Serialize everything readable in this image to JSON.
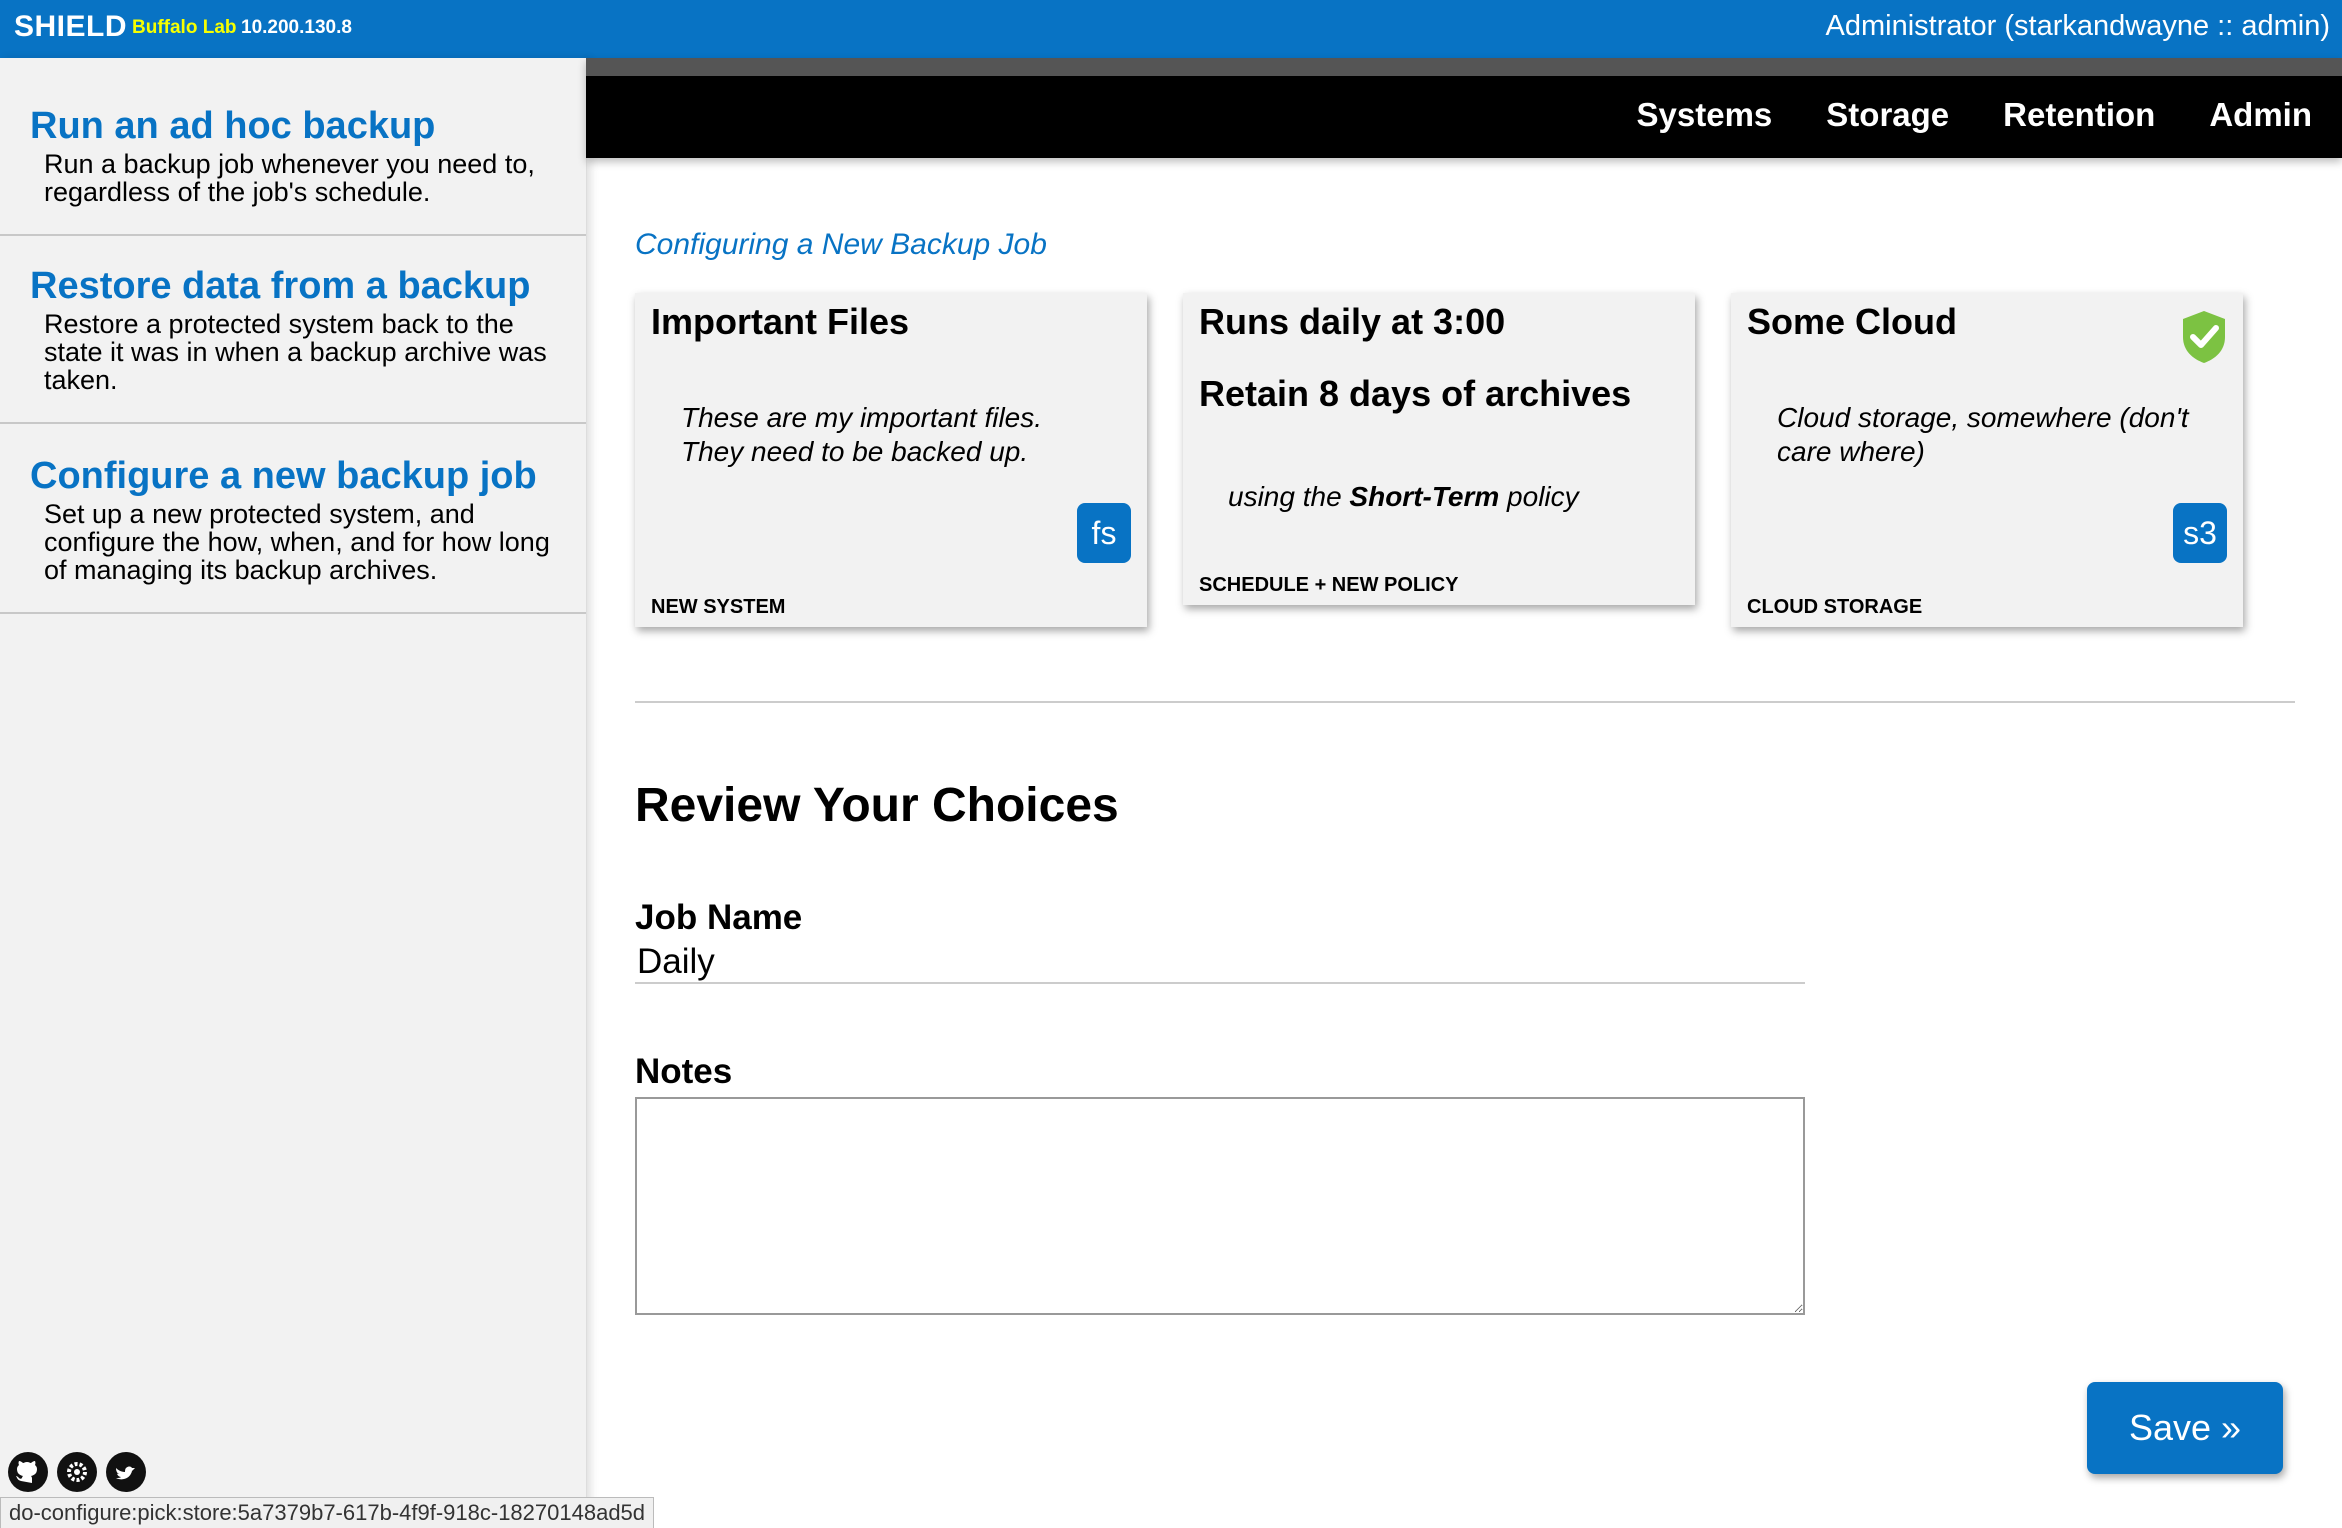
{
  "header": {
    "brand": "SHIELD",
    "environment": "Buffalo Lab",
    "ip": "10.200.130.8",
    "user": "Administrator (starkandwayne :: admin)"
  },
  "sidebar": {
    "items": [
      {
        "title": "Run an ad hoc backup",
        "description": "Run a backup job whenever you need to, regardless of the job's schedule."
      },
      {
        "title": "Restore data from a backup",
        "description": "Restore a protected system back to the state it was in when a backup archive was taken."
      },
      {
        "title": "Configure a new backup job",
        "description": "Set up a new protected system, and configure the how, when, and for how long of managing its backup archives."
      }
    ],
    "social_icons": [
      "github-icon",
      "settings-icon",
      "twitter-icon"
    ],
    "status_url": "do-configure:pick:store:5a7379b7-617b-4f9f-918c-18270148ad5d"
  },
  "nav": {
    "items": [
      "Systems",
      "Storage",
      "Retention",
      "Admin"
    ]
  },
  "main": {
    "subtitle": "Configuring a New Backup Job",
    "cards": {
      "system": {
        "title": "Important Files",
        "line1": "These are my important files.",
        "line2": "They need to be backed up.",
        "badge": "fs",
        "footer": "NEW SYSTEM"
      },
      "schedule": {
        "title": "Runs daily at 3:00",
        "subtitle": "Retain 8 days of archives",
        "policy_prefix": "using the ",
        "policy_name": "Short-Term",
        "policy_suffix": " policy",
        "footer": "SCHEDULE + NEW POLICY"
      },
      "storage": {
        "title": "Some Cloud",
        "line1": "Cloud storage, somewhere (don't",
        "line2": "care where)",
        "badge": "s3",
        "footer": "CLOUD STORAGE",
        "status_icon": "shield-check-icon"
      }
    },
    "review_title": "Review Your Choices",
    "job_name_label": "Job Name",
    "job_name_value": "Daily",
    "notes_label": "Notes",
    "notes_value": "",
    "save_label": "Save »"
  },
  "colors": {
    "accent": "#0873c4",
    "environment": "#f6ff00",
    "success": "#7cc242"
  }
}
